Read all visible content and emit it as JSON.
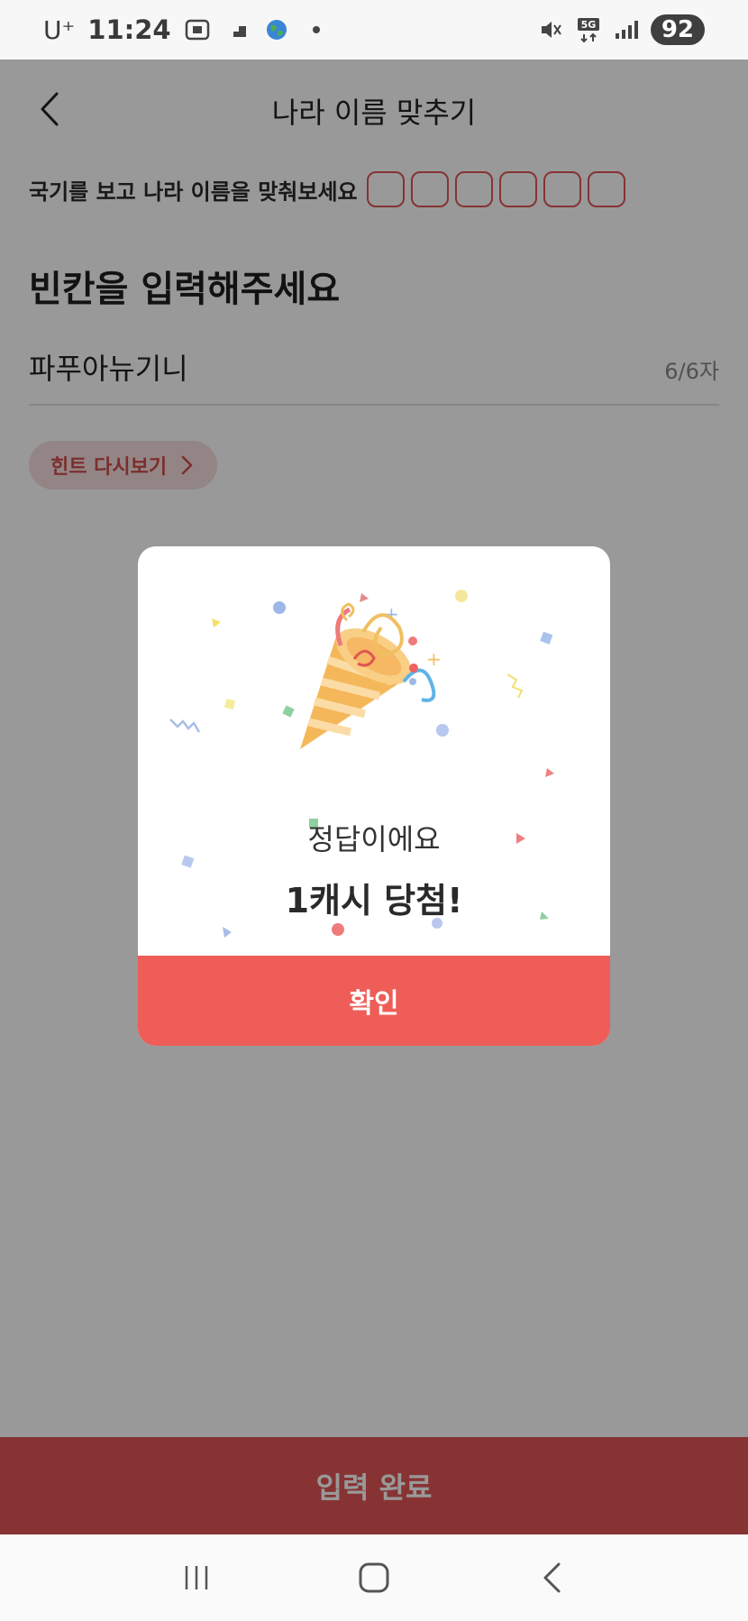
{
  "status_bar": {
    "carrier": "U⁺",
    "time": "11:24",
    "battery": "92",
    "network": "5G"
  },
  "header": {
    "title": "나라 이름 맞추기"
  },
  "quiz": {
    "instruction": "국기를 보고  나라 이름을 맞춰보세요",
    "blank_count": 6,
    "section_title": "빈칸을 입력해주세요",
    "answer_value": "파푸아뉴기니",
    "char_count": "6/6자",
    "hint_label": "힌트 다시보기"
  },
  "submit": {
    "label": "입력 완료"
  },
  "modal": {
    "message": "정답이에요",
    "prize": "1캐시 당첨!",
    "confirm_label": "확인"
  },
  "colors": {
    "accent": "#e25656",
    "modal_button": "#ee5d58",
    "blank_border": "#e05555",
    "hint_bg": "#f5dede"
  },
  "icons": {
    "back": "chevron-left-icon",
    "hint": "chevron-right-icon",
    "celebration": "party-popper-icon"
  }
}
